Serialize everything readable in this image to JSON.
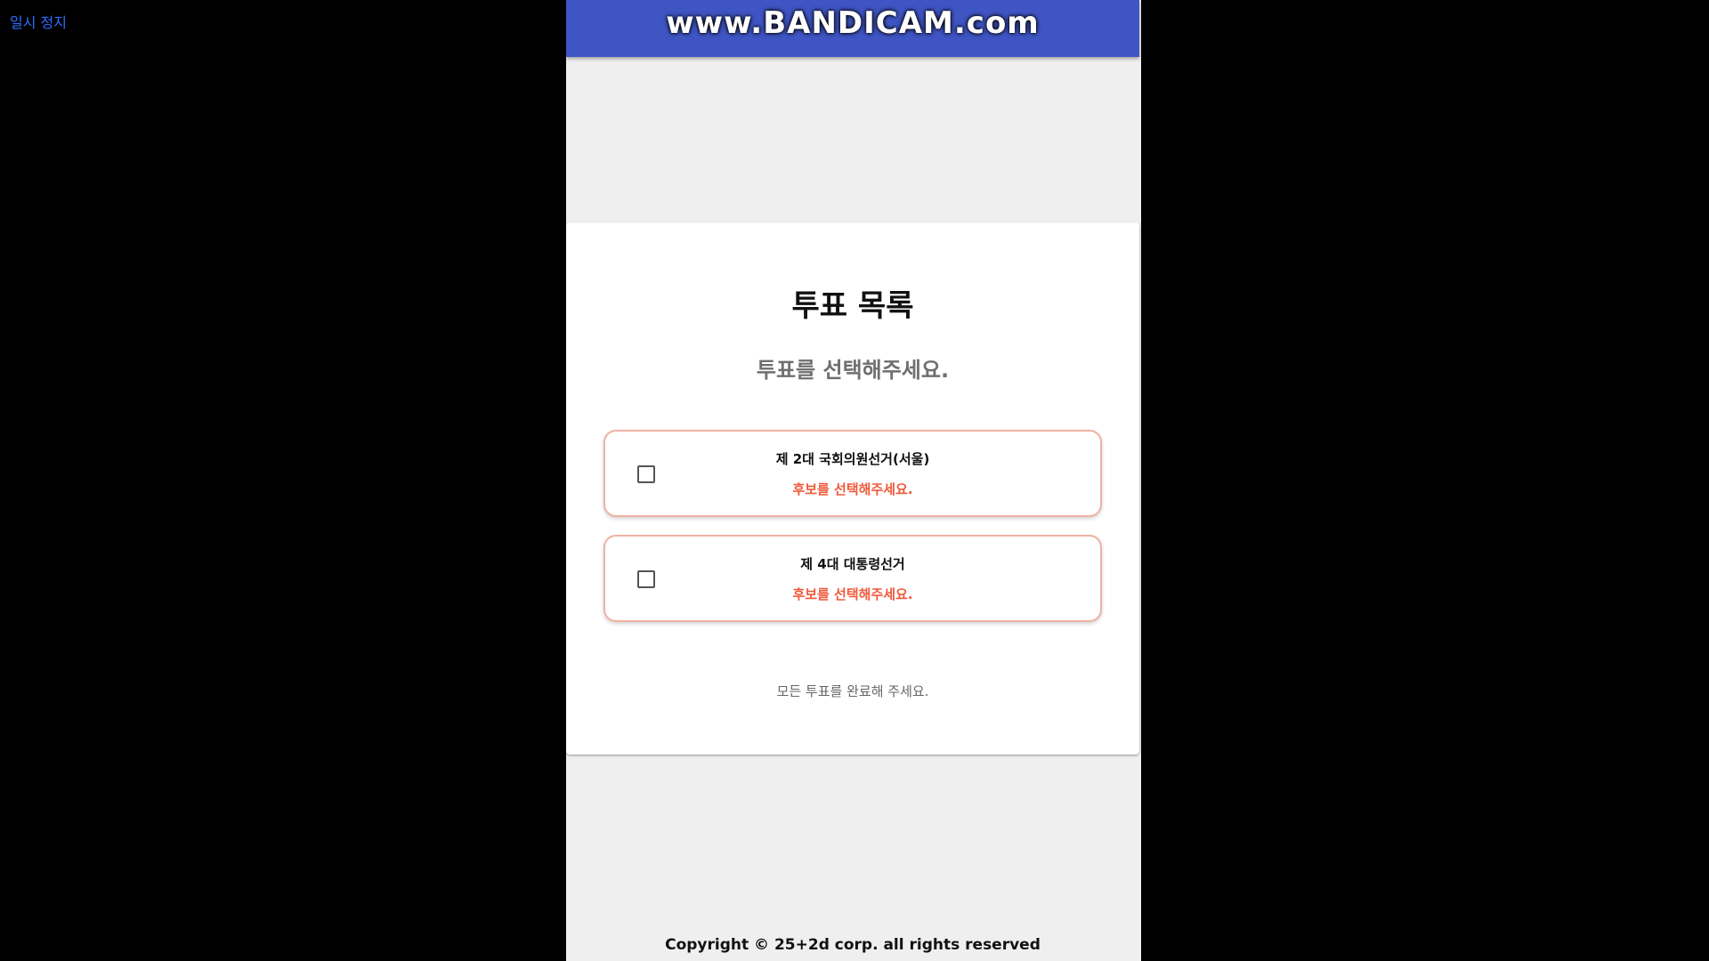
{
  "player": {
    "pause_label": "일시 정지"
  },
  "overlay": {
    "watermark": "www.BANDICAM.com"
  },
  "page": {
    "title": "투표 목록",
    "subtitle": "투표를 선택해주세요.",
    "votes": [
      {
        "name": "제 2대 국회의원선거(서울)",
        "status": "후보를 선택해주세요.",
        "checked": false
      },
      {
        "name": "제 4대 대통령선거",
        "status": "후보를 선택해주세요.",
        "checked": false
      }
    ],
    "complete_note": "모든 투표를 완료해 주세요.",
    "footer": "Copyright © 25+2d corp. all rights reserved"
  },
  "colors": {
    "background": "#000000",
    "header_blue": "#3f55c4",
    "accent_red": "#f05a3c",
    "card_border": "#f0b2a3",
    "pause_link": "#2f6dff"
  }
}
